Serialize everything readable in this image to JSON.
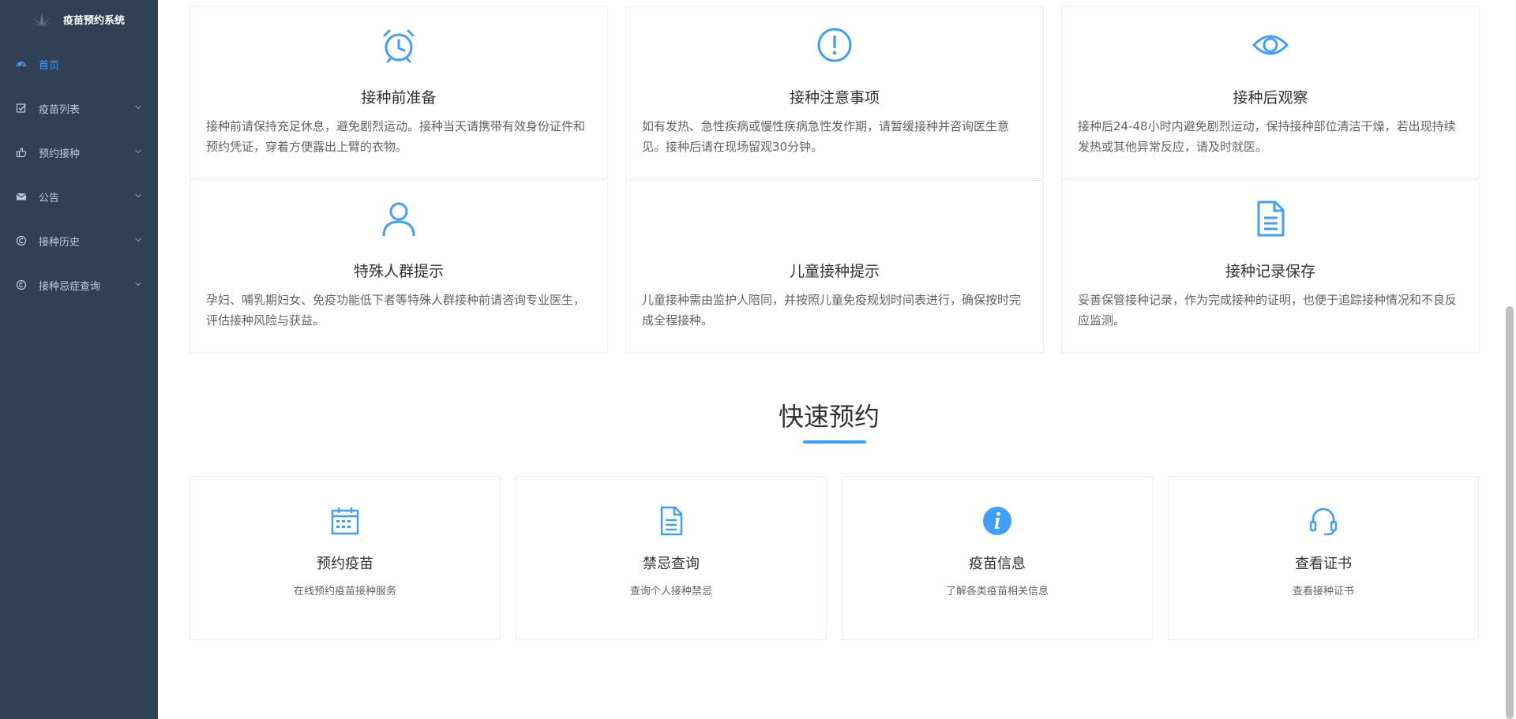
{
  "app": {
    "title": "疫苗预约系统"
  },
  "sidebar": {
    "items": [
      {
        "label": "首页",
        "icon": "dashboard-icon",
        "active": true,
        "has_arrow": false
      },
      {
        "label": "疫苗列表",
        "icon": "checkbox-icon",
        "active": false,
        "has_arrow": true
      },
      {
        "label": "预约接种",
        "icon": "hand-icon",
        "active": false,
        "has_arrow": true
      },
      {
        "label": "公告",
        "icon": "envelope-icon",
        "active": false,
        "has_arrow": true
      },
      {
        "label": "接种历史",
        "icon": "copyright-icon",
        "active": false,
        "has_arrow": true
      },
      {
        "label": "接种忌症查询",
        "icon": "copyright-icon",
        "active": false,
        "has_arrow": true
      }
    ]
  },
  "info_cards": [
    {
      "icon": "alarm-clock-icon",
      "title": "接种前准备",
      "text": "接种前请保持充足休息，避免剧烈运动。接种当天请携带有效身份证件和预约凭证，穿着方便露出上臂的衣物。"
    },
    {
      "icon": "exclamation-circle-icon",
      "title": "接种注意事项",
      "text": "如有发热、急性疾病或慢性疾病急性发作期，请暂缓接种并咨询医生意见。接种后请在现场留观30分钟。"
    },
    {
      "icon": "eye-icon",
      "title": "接种后观察",
      "text": "接种后24-48小时内避免剧烈运动，保持接种部位清洁干燥，若出现持续发热或其他异常反应，请及时就医。"
    },
    {
      "icon": "user-icon",
      "title": "特殊人群提示",
      "text": "孕妇、哺乳期妇女、免疫功能低下者等特殊人群接种前请咨询专业医生，评估接种风险与获益。"
    },
    {
      "icon": "",
      "title": "儿童接种提示",
      "text": "儿童接种需由监护人陪同，并按照儿童免疫规划时间表进行，确保按时完成全程接种。"
    },
    {
      "icon": "document-icon",
      "title": "接种记录保存",
      "text": "妥善保管接种记录，作为完成接种的证明，也便于追踪接种情况和不良反应监测。"
    }
  ],
  "quick_section": {
    "title": "快速预约",
    "cards": [
      {
        "icon": "calendar-icon",
        "title": "预约疫苗",
        "desc": "在线预约疫苗接种服务"
      },
      {
        "icon": "document-icon",
        "title": "禁忌查询",
        "desc": "查询个人接种禁忌"
      },
      {
        "icon": "info-circle-icon",
        "title": "疫苗信息",
        "desc": "了解各类疫苗相关信息"
      },
      {
        "icon": "headset-icon",
        "title": "查看证书",
        "desc": "查看接种证书"
      }
    ]
  },
  "colors": {
    "sidebar_bg": "#304156",
    "sidebar_text": "#bfcbd9",
    "accent": "#409eff"
  }
}
